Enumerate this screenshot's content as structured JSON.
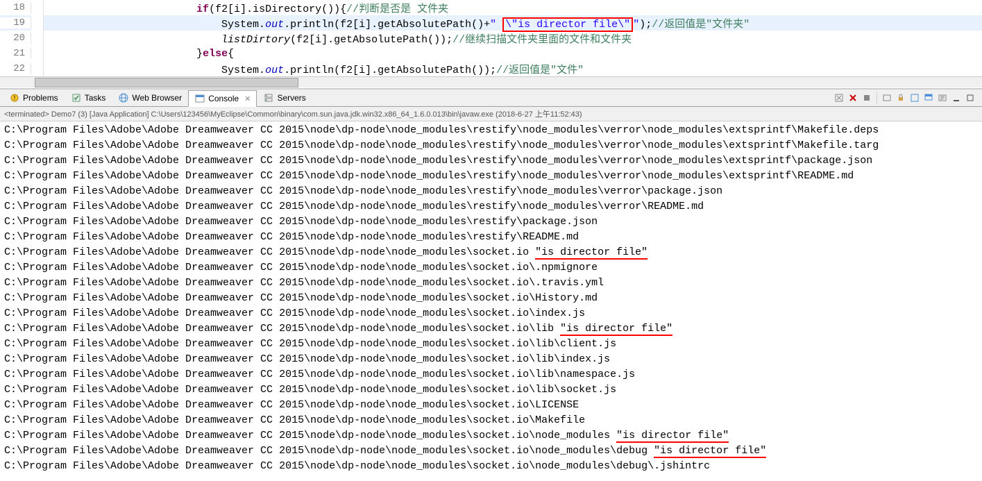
{
  "editor": {
    "lines": [
      {
        "num": "18",
        "indent": "                        ",
        "parts": [
          {
            "t": "if",
            "c": "kw"
          },
          {
            "t": "(f2[i].isDirectory()){",
            "c": ""
          },
          {
            "t": "//判断是否是 文件夹",
            "c": "comment"
          }
        ],
        "hl": false
      },
      {
        "num": "19",
        "indent": "                            ",
        "parts": [
          {
            "t": "System.",
            "c": ""
          },
          {
            "t": "out",
            "c": "field"
          },
          {
            "t": ".println(f2[i].getAbsolutePath()+",
            "c": ""
          },
          {
            "t": "\" ",
            "c": "str"
          },
          {
            "t": "\\\"is director file\\\"",
            "c": "str",
            "box": true
          },
          {
            "t": "\"",
            "c": "str"
          },
          {
            "t": ");",
            "c": ""
          },
          {
            "t": "//返回值是\"文件夹\"",
            "c": "comment"
          }
        ],
        "hl": true
      },
      {
        "num": "20",
        "indent": "                            ",
        "parts": [
          {
            "t": "listDirtory",
            "c": "method-italic"
          },
          {
            "t": "(f2[i].getAbsolutePath());",
            "c": ""
          },
          {
            "t": "//继续扫描文件夹里面的文件和文件夹",
            "c": "comment"
          }
        ],
        "hl": false
      },
      {
        "num": "21",
        "indent": "                        ",
        "parts": [
          {
            "t": "}",
            "c": ""
          },
          {
            "t": "else",
            "c": "kw"
          },
          {
            "t": "{",
            "c": ""
          }
        ],
        "hl": false
      },
      {
        "num": "22",
        "indent": "                            ",
        "parts": [
          {
            "t": "System.",
            "c": ""
          },
          {
            "t": "out",
            "c": "field"
          },
          {
            "t": ".println(f2[i].getAbsolutePath());",
            "c": ""
          },
          {
            "t": "//返回值是\"文件\"",
            "c": "comment"
          }
        ],
        "hl": false
      }
    ]
  },
  "tabs": {
    "items": [
      {
        "label": "Problems",
        "icon": "problems"
      },
      {
        "label": "Tasks",
        "icon": "tasks"
      },
      {
        "label": "Web Browser",
        "icon": "browser"
      },
      {
        "label": "Console",
        "icon": "console",
        "active": true
      },
      {
        "label": "Servers",
        "icon": "servers"
      }
    ]
  },
  "terminated": "<terminated> Demo7 (3) [Java Application] C:\\Users\\123456\\MyEclipse\\Common\\binary\\com.sun.java.jdk.win32.x86_64_1.6.0.013\\bin\\javaw.exe (2018-6-27 上午11:52:43)",
  "console": {
    "basePath": "C:\\Program Files\\Adobe\\Adobe Dreamweaver CC 2015\\node\\dp-node\\node_modules\\",
    "lines": [
      {
        "path": "restify\\node_modules\\verror\\node_modules\\extsprintf\\Makefile.deps",
        "dir": false
      },
      {
        "path": "restify\\node_modules\\verror\\node_modules\\extsprintf\\Makefile.targ",
        "dir": false
      },
      {
        "path": "restify\\node_modules\\verror\\node_modules\\extsprintf\\package.json",
        "dir": false
      },
      {
        "path": "restify\\node_modules\\verror\\node_modules\\extsprintf\\README.md",
        "dir": false
      },
      {
        "path": "restify\\node_modules\\verror\\package.json",
        "dir": false
      },
      {
        "path": "restify\\node_modules\\verror\\README.md",
        "dir": false
      },
      {
        "path": "restify\\package.json",
        "dir": false
      },
      {
        "path": "restify\\README.md",
        "dir": false
      },
      {
        "path": "socket.io",
        "dir": true
      },
      {
        "path": "socket.io\\.npmignore",
        "dir": false
      },
      {
        "path": "socket.io\\.travis.yml",
        "dir": false
      },
      {
        "path": "socket.io\\History.md",
        "dir": false
      },
      {
        "path": "socket.io\\index.js",
        "dir": false
      },
      {
        "path": "socket.io\\lib",
        "dir": true
      },
      {
        "path": "socket.io\\lib\\client.js",
        "dir": false
      },
      {
        "path": "socket.io\\lib\\index.js",
        "dir": false
      },
      {
        "path": "socket.io\\lib\\namespace.js",
        "dir": false
      },
      {
        "path": "socket.io\\lib\\socket.js",
        "dir": false
      },
      {
        "path": "socket.io\\LICENSE",
        "dir": false
      },
      {
        "path": "socket.io\\Makefile",
        "dir": false
      },
      {
        "path": "socket.io\\node_modules",
        "dir": true
      },
      {
        "path": "socket.io\\node_modules\\debug",
        "dir": true
      },
      {
        "path": "socket.io\\node_modules\\debug\\.jshintrc",
        "dir": false
      }
    ],
    "dirMarker": "\"is director file\""
  }
}
